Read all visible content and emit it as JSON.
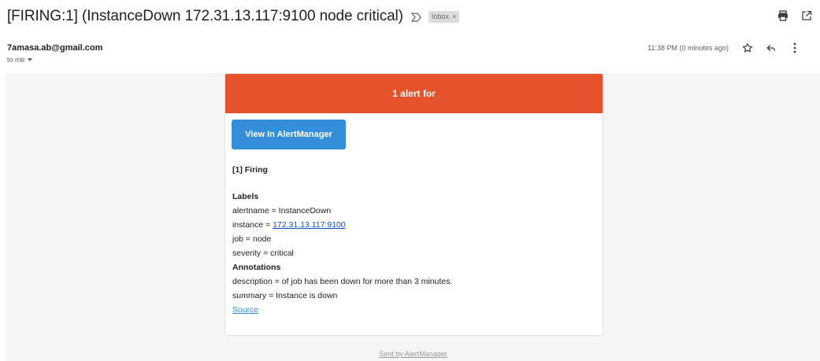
{
  "subject": "[FIRING:1] (InstanceDown 172.31.13.117:9100 node critical)",
  "label_chip": {
    "text": "Inbox",
    "remove": "×"
  },
  "header_icons": {
    "print": "printer-icon",
    "popout": "open-new-window-icon",
    "important": "important-marker-icon"
  },
  "sender": {
    "email": "7amasa.ab@gmail.com",
    "to": "to me"
  },
  "time": "11:38 PM (0 minutes ago)",
  "actions": {
    "star": "star-icon",
    "reply": "reply-icon",
    "more": "more-vert-icon"
  },
  "alert": {
    "banner": "1 alert for",
    "button": "View In AlertManager",
    "firing_heading": "[1] Firing",
    "labels_heading": "Labels",
    "alertname": "alertname = InstanceDown",
    "instance_prefix": "instance = ",
    "instance_link": "172.31.13.117:9100",
    "job": "job = node",
    "severity": "severity = critical",
    "annotations_heading": "Annotations",
    "description": "description = of job has been down for more than 3 minutes.",
    "summary": "summary = Instance is down",
    "source_link": "Source"
  },
  "footer": "Sent by AlertManager",
  "colors": {
    "banner": "#e6522c",
    "button": "#348eda",
    "link": "#1155cc"
  }
}
